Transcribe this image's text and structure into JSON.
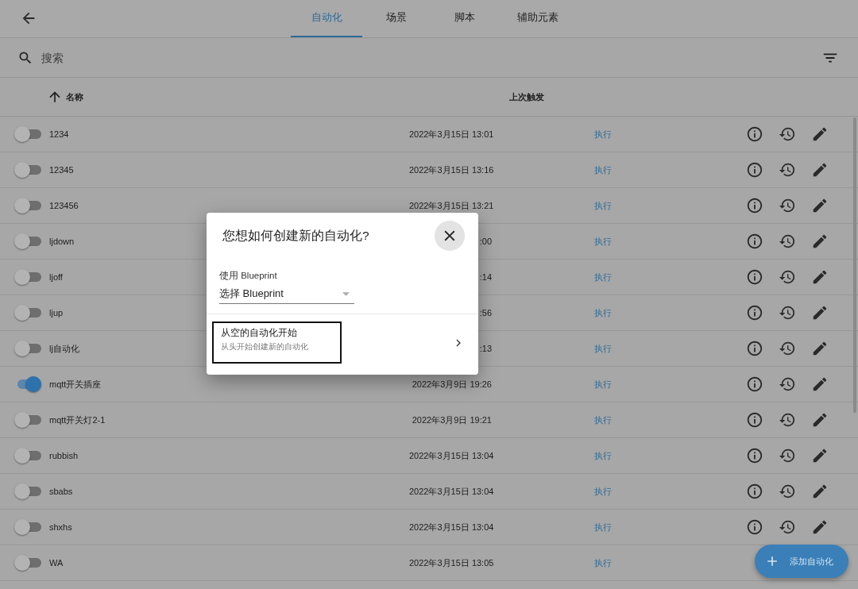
{
  "top_bar": {
    "tabs": [
      {
        "label": "自动化",
        "selected": true
      },
      {
        "label": "场景",
        "selected": false
      },
      {
        "label": "脚本",
        "selected": false
      },
      {
        "label": "辅助元素",
        "selected": false
      }
    ]
  },
  "search": {
    "placeholder": "搜索"
  },
  "table": {
    "columns": [
      {
        "label": "名称",
        "sorted_ascending": true
      },
      {
        "label": "上次触发"
      }
    ],
    "rows": [
      {
        "name": "1234",
        "enabled": false,
        "last_triggered": "2022年3月15日 13:01",
        "action": "执行"
      },
      {
        "name": "12345",
        "enabled": false,
        "last_triggered": "2022年3月15日 13:16",
        "action": "执行"
      },
      {
        "name": "123456",
        "enabled": false,
        "last_triggered": "2022年3月15日 13:21",
        "action": "执行"
      },
      {
        "name": "ljdown",
        "enabled": false,
        "last_triggered": ":00",
        "action": "执行"
      },
      {
        "name": "ljoff",
        "enabled": false,
        "last_triggered": ":14",
        "action": "执行"
      },
      {
        "name": "ljup",
        "enabled": false,
        "last_triggered": ":56",
        "action": "执行"
      },
      {
        "name": "lj自动化",
        "enabled": false,
        "last_triggered": ":13",
        "action": "执行"
      },
      {
        "name": "mqtt开关插座",
        "enabled": true,
        "last_triggered": "2022年3月9日 19:26",
        "action": "执行"
      },
      {
        "name": "mqtt开关灯2-1",
        "enabled": false,
        "last_triggered": "2022年3月9日 19:21",
        "action": "执行"
      },
      {
        "name": "rubbish",
        "enabled": false,
        "last_triggered": "2022年3月15日 13:04",
        "action": "执行"
      },
      {
        "name": "sbabs",
        "enabled": false,
        "last_triggered": "2022年3月15日 13:04",
        "action": "执行"
      },
      {
        "name": "shxhs",
        "enabled": false,
        "last_triggered": "2022年3月15日 13:04",
        "action": "执行"
      },
      {
        "name": "WA",
        "enabled": false,
        "last_triggered": "2022年3月15日 13:05",
        "action": "执行"
      }
    ]
  },
  "fab": {
    "label": "添加自动化"
  },
  "dialog": {
    "title": "您想如何创建新的自动化?",
    "blueprint_label": "使用 Blueprint",
    "blueprint_select": {
      "value": "选择 Blueprint"
    },
    "option": {
      "title": "从空的自动化开始",
      "subtitle": "从头开始创建新的自动化",
      "highlighted": true
    }
  }
}
